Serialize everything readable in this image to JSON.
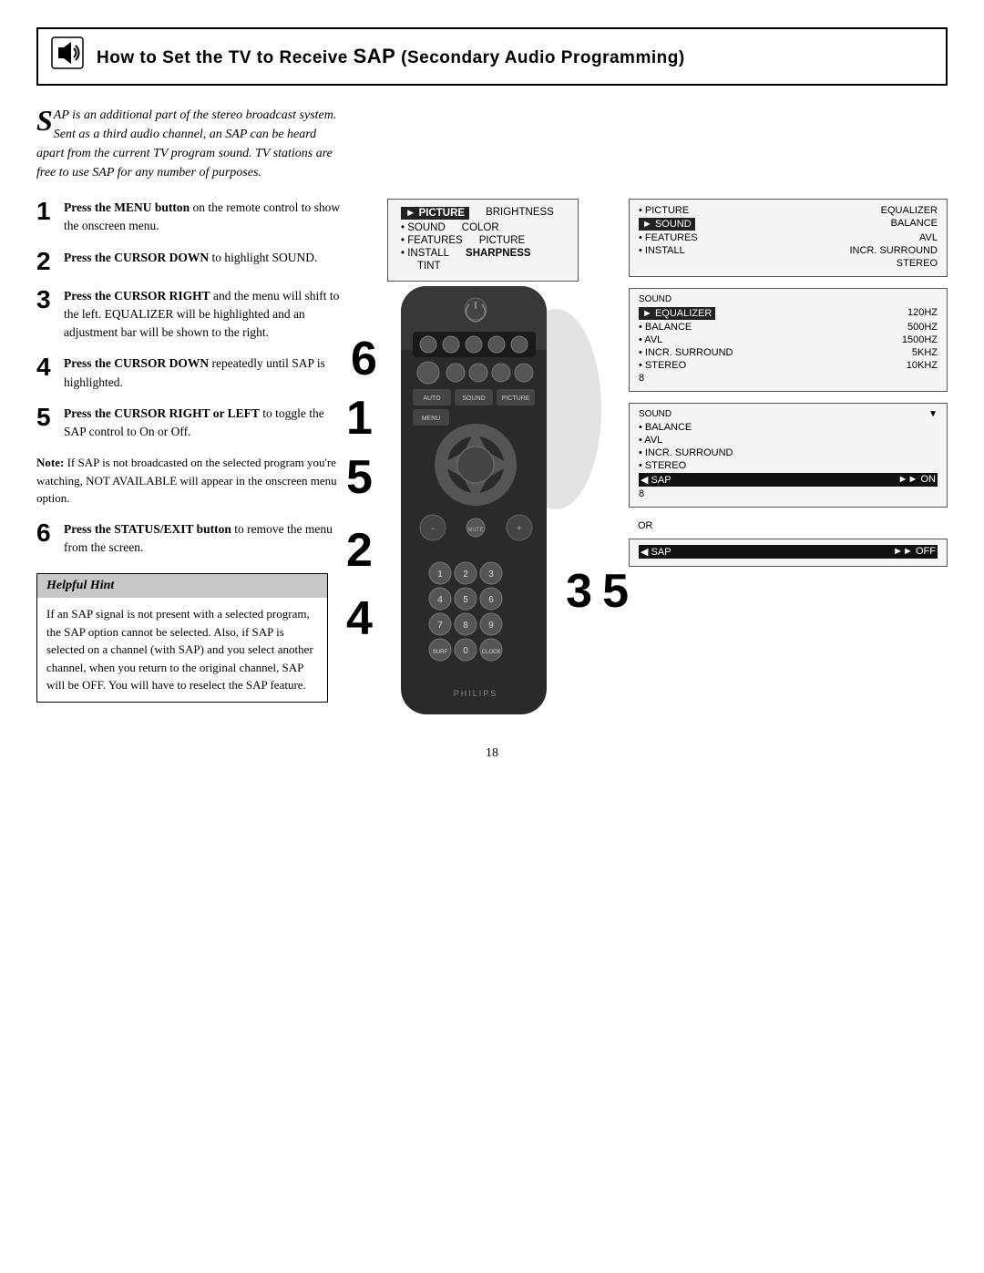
{
  "header": {
    "title": "How to Set the TV to Receive SAP (Secondary Audio Programming)",
    "title_parts": {
      "how_to_set_the": "How to Set the",
      "tv": "TV",
      "to_receive": "to Receive",
      "sap": "SAP",
      "secondary": "(Secondary Audio Programming)"
    }
  },
  "intro": {
    "drop_cap": "S",
    "text": "AP is an additional part of the stereo broadcast system.  Sent as a third audio channel, an SAP can be heard apart from the current TV program sound.  TV stations are free to use SAP for any number of purposes."
  },
  "steps": [
    {
      "num": "1",
      "text_bold": "Press the MENU button",
      "text": " on the remote control to show the onscreen menu."
    },
    {
      "num": "2",
      "text_bold": "Press the CURSOR DOWN",
      "text": " to highlight SOUND."
    },
    {
      "num": "3",
      "text_bold": "Press the CURSOR RIGHT",
      "text": " and the menu will shift to the left. EQUALIZER will be highlighted and an adjustment bar will be shown to the right."
    },
    {
      "num": "4",
      "text_bold": "Press the CURSOR DOWN",
      "text": " repeatedly until SAP is highlighted."
    },
    {
      "num": "5",
      "text_bold": "Press the CURSOR RIGHT or LEFT",
      "text": " to toggle the SAP control to On or Off."
    },
    {
      "num": "6",
      "text_bold": "Press the STATUS/EXIT button",
      "text": " to remove the menu from the screen."
    }
  ],
  "note": {
    "label": "Note:",
    "text": " If SAP is not broadcasted on the selected program you're watching, NOT AVAILABLE will appear in the onscreen menu option."
  },
  "hint": {
    "title": "Helpful Hint",
    "body": "If an SAP signal is not present with a selected program, the SAP option cannot be selected.  Also, if SAP is selected on a channel (with SAP) and you select another channel, when you return to the original channel, SAP will be OFF.  You will have to reselect the SAP feature."
  },
  "menus": {
    "menu1": {
      "items_left": [
        "PICTURE",
        "SOUND",
        "FEATURES",
        "INSTALL"
      ],
      "items_right": [
        "BRIGHTNESS",
        "COLOR",
        "PICTURE",
        "SHARPNESS",
        "TINT"
      ],
      "highlighted_left": "PICTURE",
      "highlighted_right": "BRIGHTNESS"
    },
    "menu2": {
      "items_left": [
        "PICTURE",
        "SOUND",
        "FEATURES",
        "INSTALL"
      ],
      "items_right": [
        "EQUALIZER",
        "BALANCE",
        "AVL",
        "INCR. SURROUND",
        "STEREO"
      ],
      "highlighted_left": "SOUND",
      "highlighted_right": "EQUALIZER"
    },
    "menu3": {
      "label": "SOUND",
      "items_left": [
        "EQUALIZER",
        "BALANCE",
        "AVL",
        "INCR. SURROUND",
        "STEREO"
      ],
      "items_right": [
        "120HZ",
        "500HZ",
        "1500HZ",
        "5KHZ",
        "10KHZ"
      ],
      "highlighted_left": "EQUALIZER"
    },
    "menu4": {
      "label": "SOUND",
      "items": [
        "BALANCE",
        "AVL",
        "INCR. SURROUND",
        "STEREO"
      ],
      "sap_row": {
        "label": "SAP",
        "value": "ON",
        "highlighted": true
      },
      "extra": "8"
    },
    "menu5": {
      "sap_row": {
        "label": "SAP",
        "value": "OFF",
        "highlighted": true
      }
    }
  },
  "page_number": "18",
  "remote_labels": {
    "philips": "PHILIPS"
  },
  "overlay_numbers": {
    "n6_top": "6",
    "n1": "1",
    "n5": "5",
    "n2": "2",
    "n3": "3",
    "n4": "4",
    "n5b": "5"
  }
}
